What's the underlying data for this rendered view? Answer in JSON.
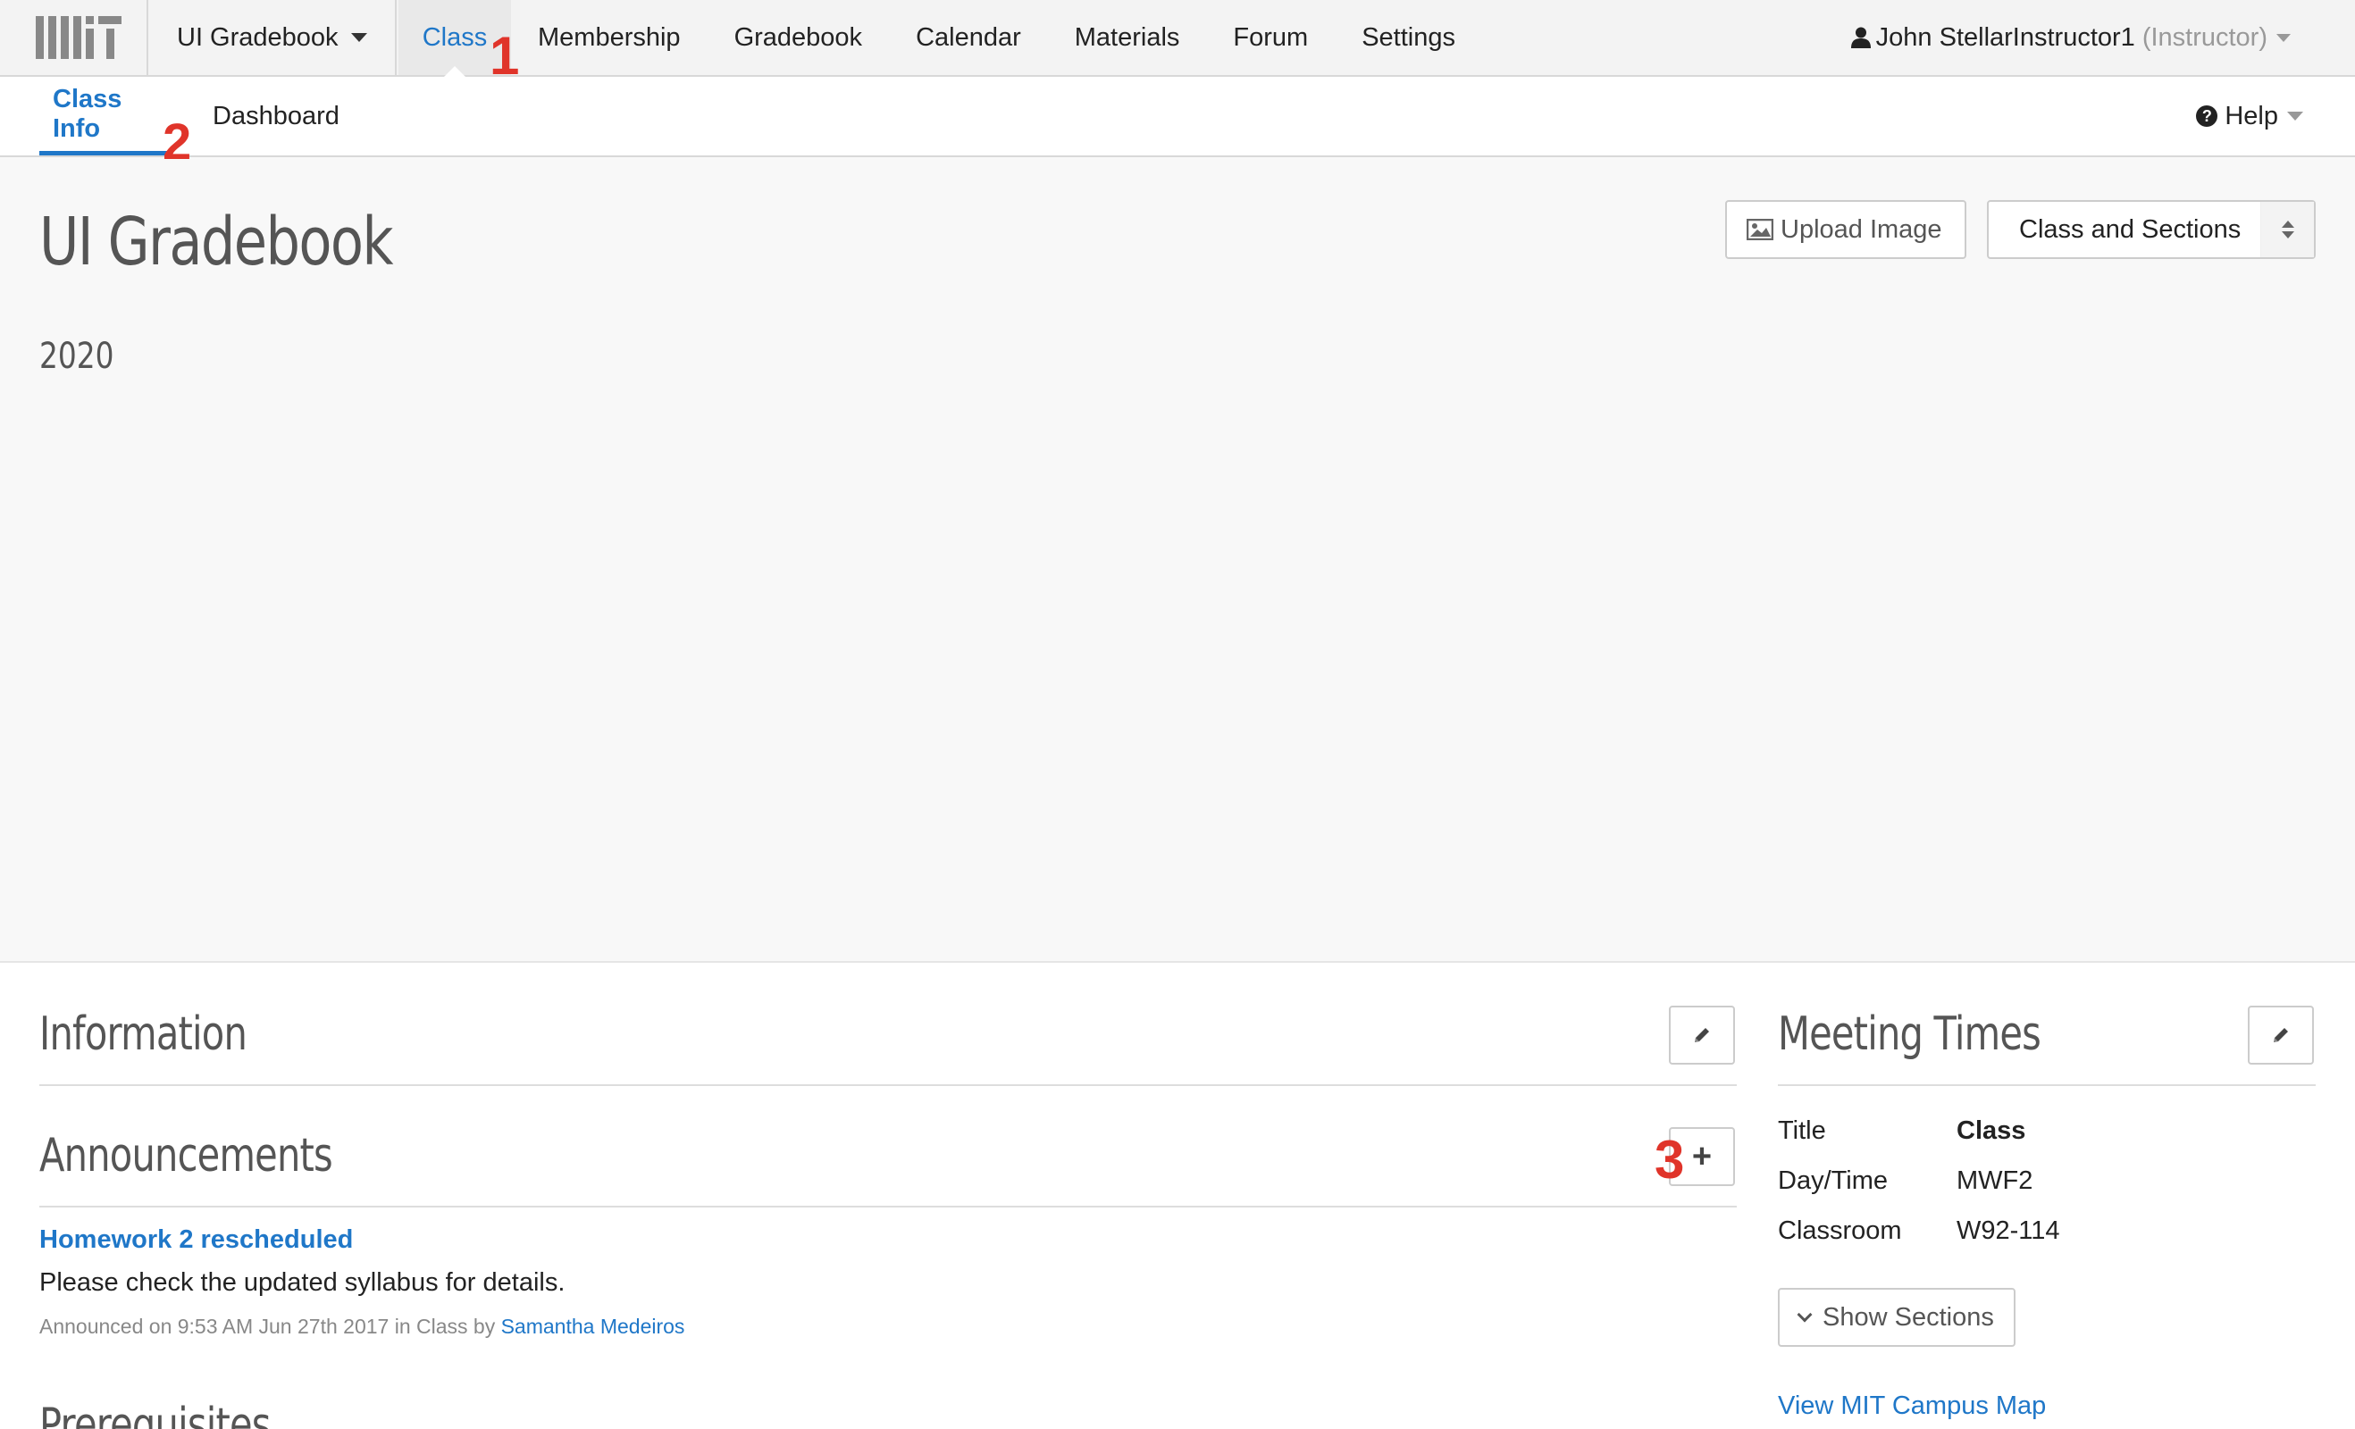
{
  "topnav": {
    "course": "UI Gradebook",
    "tabs": [
      "Class",
      "Membership",
      "Gradebook",
      "Calendar",
      "Materials",
      "Forum",
      "Settings"
    ],
    "active_tab": "Class",
    "user_name": "John StellarInstructor1",
    "user_role": "(Instructor)"
  },
  "subnav": {
    "tabs": [
      "Class Info",
      "Dashboard"
    ],
    "active_tab": "Class Info",
    "help_label": "Help"
  },
  "markers": [
    "1",
    "2",
    "3"
  ],
  "hero": {
    "title": "UI Gradebook",
    "year": "2020",
    "upload_label": "Upload Image",
    "select_value": "Class and Sections"
  },
  "sections": {
    "information": "Information",
    "announcements": "Announcements",
    "prerequisites": "Prerequisites",
    "meeting_times": "Meeting Times"
  },
  "announcement": {
    "title": "Homework 2 rescheduled",
    "body": "Please check the updated syllabus for details.",
    "meta_prefix": "Announced on 9:53 AM Jun 27th 2017 in Class by",
    "author": "Samantha Medeiros"
  },
  "meeting": {
    "rows": [
      {
        "label": "Title",
        "value": "Class"
      },
      {
        "label": "Day/Time",
        "value": "MWF2"
      },
      {
        "label": "Classroom",
        "value": "W92-114"
      }
    ],
    "show_sections_label": "Show Sections",
    "map_link": "View MIT Campus Map"
  },
  "colors": {
    "accent": "#1f77c8",
    "marker": "#e0342a"
  },
  "icons": [
    "mit-logo",
    "caret-down-icon",
    "user-icon",
    "help-circle-icon",
    "image-icon",
    "sort-arrows-icon",
    "pencil-icon",
    "plus-icon",
    "chevron-down-icon"
  ]
}
